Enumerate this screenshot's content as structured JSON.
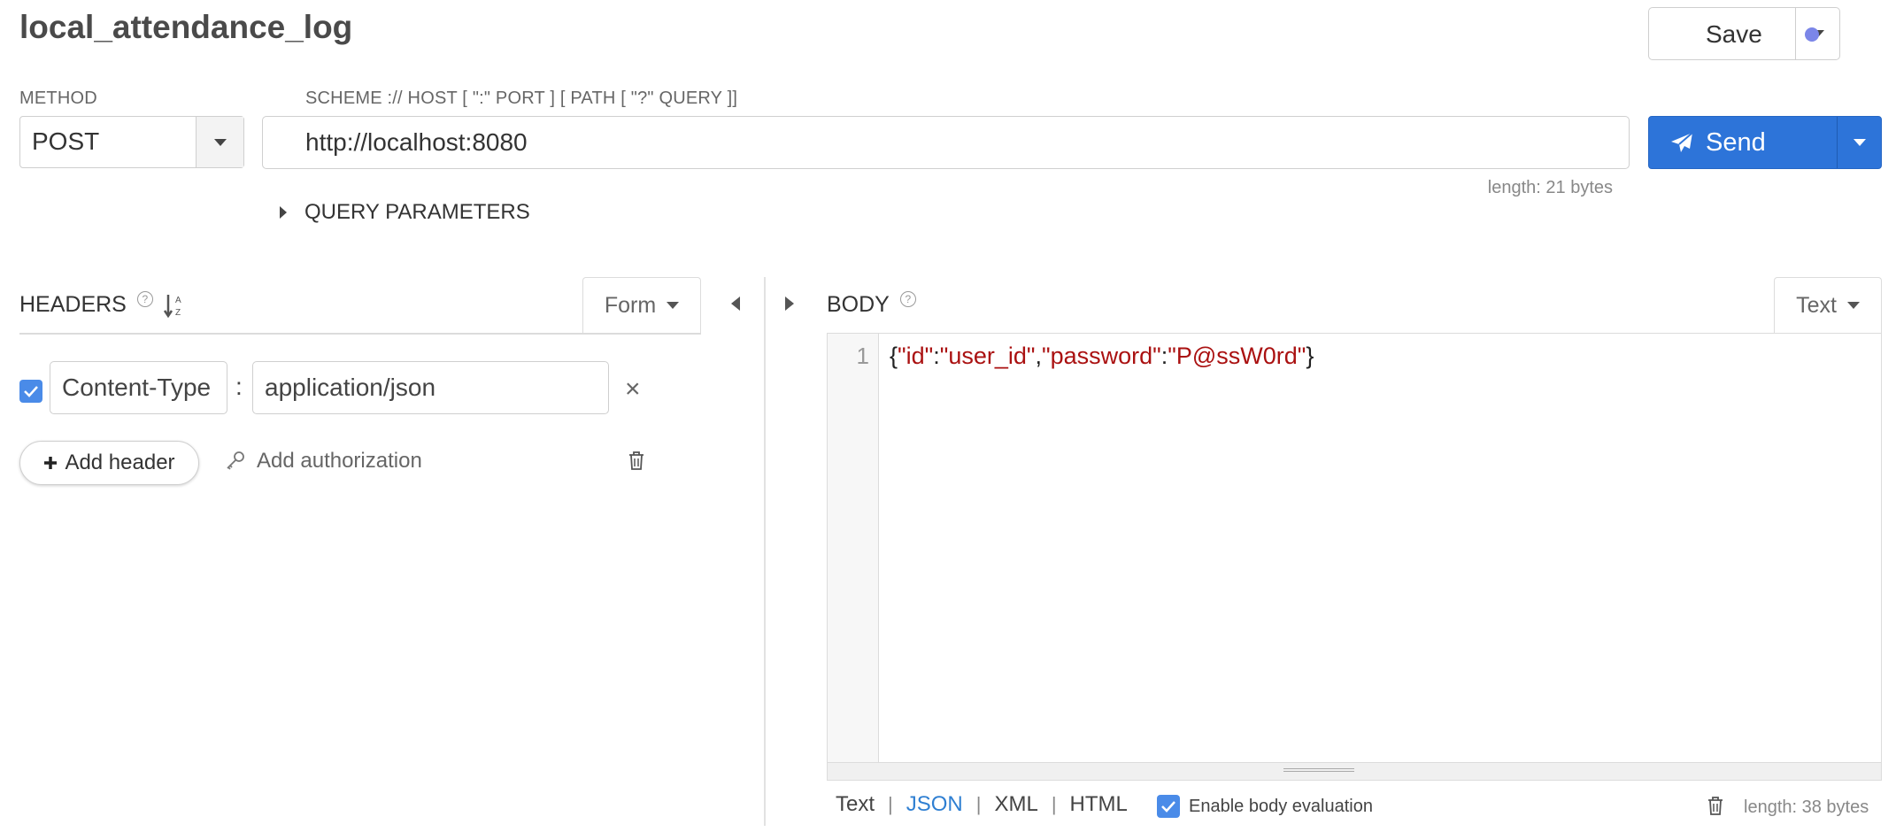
{
  "request": {
    "title": "local_attendance_log",
    "save_label": "Save",
    "method_label": "METHOD",
    "method_value": "POST",
    "url_label": "SCHEME :// HOST [ \":\" PORT ] [ PATH [ \"?\" QUERY ]]",
    "url_value": "http://localhost:8080",
    "send_label": "Send",
    "url_length": "length: 21 bytes",
    "query_parameters_label": "QUERY PARAMETERS"
  },
  "headers": {
    "title": "HEADERS",
    "help": "?",
    "mode": "Form",
    "rows": [
      {
        "key": "Content-Type",
        "separator": ":",
        "value": "application/json",
        "enabled": true
      }
    ],
    "add_header": "Add header",
    "add_authorization": "Add authorization"
  },
  "body": {
    "title": "BODY",
    "help": "?",
    "mode": "Text",
    "line_number": "1",
    "code": {
      "open": "{",
      "k1": "\"id\"",
      "c1": ":",
      "v1": "\"user_id\"",
      "comma": ",",
      "k2": "\"password\"",
      "c2": ":",
      "v2": "\"P@ssW0rd\"",
      "close": "}"
    },
    "formats": [
      "Text",
      "JSON",
      "XML",
      "HTML"
    ],
    "format_separator": "|",
    "active_format": "JSON",
    "enable_eval_label": "Enable body evaluation",
    "enable_eval": true,
    "length": "length: 38 bytes"
  },
  "icons": {
    "save_caret": "chevron-down-icon",
    "method_caret": "chevron-down-icon",
    "send": "paper-plane-icon",
    "send_caret": "chevron-down-icon",
    "query_toggle": "caret-right-icon",
    "sort": "sort-alpha-down-icon",
    "form_caret": "chevron-down-icon",
    "collapse_left": "caret-left-icon",
    "collapse_right": "caret-right-icon",
    "header_check": "checkbox-checked-icon",
    "remove": "close-icon",
    "add": "plus-icon",
    "authorization": "key-icon",
    "trash": "trash-icon",
    "text_caret": "chevron-down-icon"
  },
  "colors": {
    "send_button": "#2d74d9",
    "save_indicator": "#7b86e8",
    "checkbox": "#4a8be8",
    "json_string": "#aa1111",
    "active_format": "#2f7fd2"
  }
}
